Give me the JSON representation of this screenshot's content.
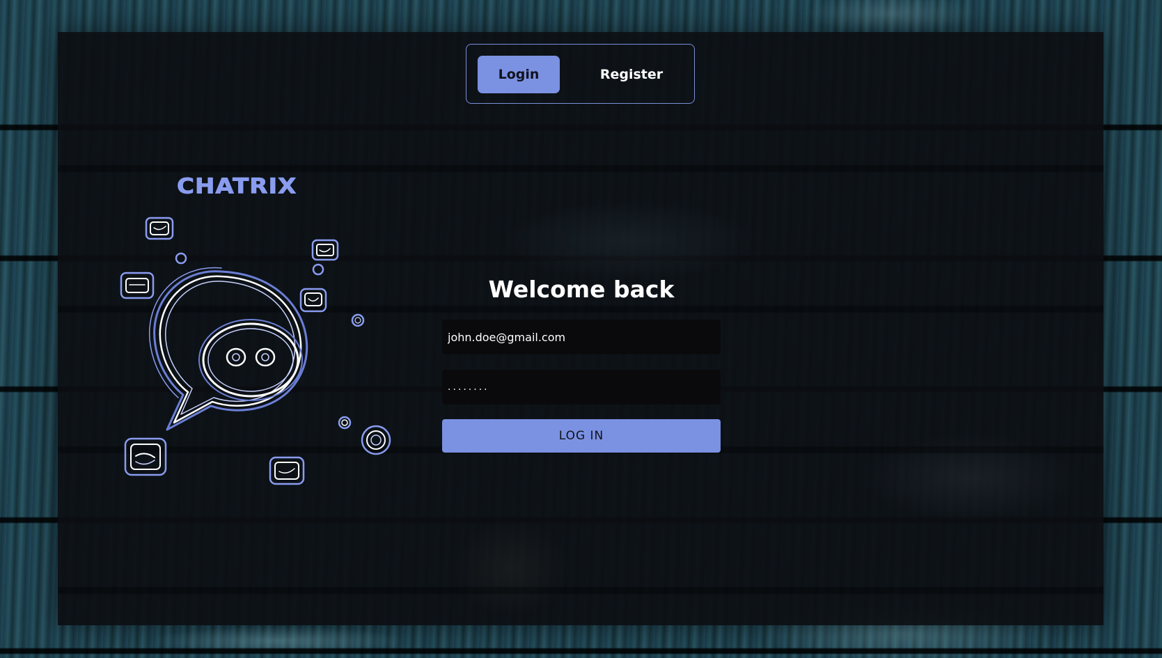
{
  "tabs": {
    "login_label": "Login",
    "register_label": "Register"
  },
  "brand": {
    "name": "CHATRIX"
  },
  "form": {
    "title": "Welcome back",
    "email_value": "john.doe@gmail.com",
    "password_value": "........",
    "submit_label": "LOG IN"
  },
  "colors": {
    "accent": "#7b91e2",
    "panel": "#0c0e12",
    "text": "#ffffff"
  },
  "icons": {
    "illustration": "chat-bubble-robot-illustration"
  }
}
